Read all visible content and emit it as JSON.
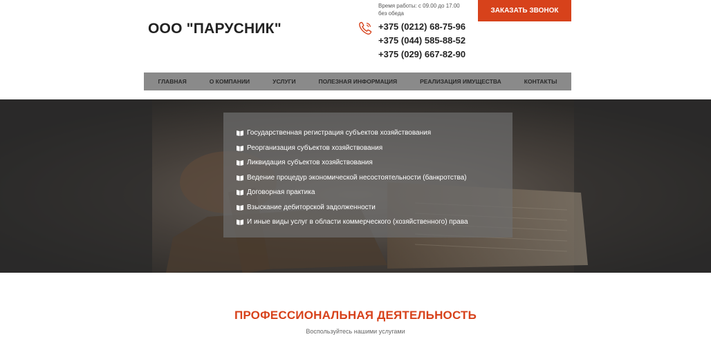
{
  "header": {
    "company": "ООО \"ПАРУСНИК\"",
    "hours_line1": "Время работы: с 09.00 до 17.00",
    "hours_line2": "без обеда",
    "phones": [
      "+375 (0212) 68-75-96",
      "+375 (044) 585-88-52",
      "+375 (029) 667-82-90"
    ],
    "phone_icon": "phone-icon",
    "call_button": "ЗАКАЗАТЬ ЗВОНОК"
  },
  "nav": {
    "items": [
      "ГЛАВНАЯ",
      "О КОМПАНИИ",
      "УСЛУГИ",
      "ПОЛЕЗНАЯ ИНФОРМАЦИЯ",
      "РЕАЛИЗАЦИЯ ИМУЩЕСТВА",
      "КОНТАКТЫ"
    ]
  },
  "hero": {
    "services": [
      "Государственная регистрация субъектов хозяйствования",
      "Реорганизация субъектов хозяйствования",
      "Ликвидация субъектов хозяйствования",
      "Ведение процедур экономической несостоятельности (банкротства)",
      "Договорная практика",
      "Взыскание дебиторской задолженности",
      "И иные виды услуг в области коммерческого (хозяйственного) права"
    ],
    "bullet_icon": "book-icon"
  },
  "section": {
    "title": "ПРОФЕССИОНАЛЬНАЯ ДЕЯТЕЛЬНОСТЬ",
    "subtitle": "Воспользуйтесь нашими услугами"
  },
  "colors": {
    "accent": "#d7421b",
    "nav_bg": "#8a8a8a",
    "hero_bg": "#3a3a3a"
  }
}
